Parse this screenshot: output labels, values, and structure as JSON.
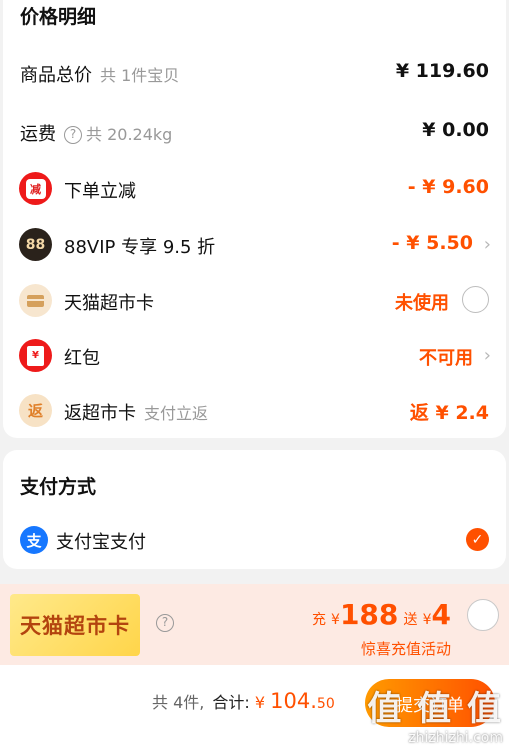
{
  "price_section": {
    "title": "价格明细",
    "rows": {
      "total": {
        "label": "商品总价",
        "sub": "共 1件宝贝",
        "value": "¥ 119.60"
      },
      "shipping": {
        "label": "运费",
        "sub": "共 20.24kg",
        "value": "¥ 0.00"
      },
      "instant_discount": {
        "label": "下单立减",
        "value": "- ¥ 9.60",
        "icon": "immediate-discount-icon"
      },
      "vip_discount": {
        "label": "88VIP 专享 9.5 折",
        "value": "- ¥ 5.50",
        "icon": "88vip-icon",
        "icon_text": "88"
      },
      "tmall_card": {
        "label": "天猫超市卡",
        "value": "未使用",
        "icon": "card-icon"
      },
      "red_packet": {
        "label": "红包",
        "value": "不可用",
        "icon": "red-envelope-icon"
      },
      "cashback": {
        "label": "返超市卡",
        "sub": "支付立返",
        "value": "返 ¥ 2.4",
        "icon": "cashback-icon",
        "icon_text": "返"
      }
    }
  },
  "payment_section": {
    "title": "支付方式",
    "method": {
      "label": "支付宝支付",
      "icon": "alipay-icon",
      "icon_text": "支",
      "selected": true
    }
  },
  "promo": {
    "badge": "天猫超市卡",
    "charge_label": "充",
    "currency": "¥",
    "charge_amount": "188",
    "gift_label": "送",
    "gift_amount": "4",
    "subtitle": "惊喜充值活动"
  },
  "bottom_bar": {
    "count": "共 4件,",
    "total_label": "合计:",
    "currency": "¥",
    "amount_int": "104.",
    "amount_dec": "50",
    "submit_label": "提交订单"
  },
  "watermark": {
    "text_cn": "值 值 值",
    "text_en": "zhizhizhi.com"
  },
  "colors": {
    "accent": "#ff5000",
    "alipay": "#1677ff",
    "promo_bg": "#fdeae3"
  }
}
